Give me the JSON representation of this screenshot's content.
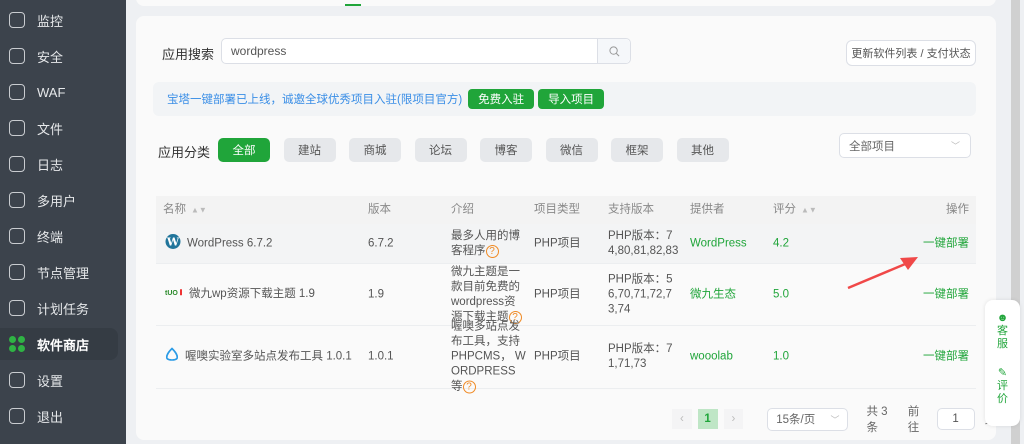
{
  "sidebar": {
    "items": [
      {
        "label": "监控",
        "icon": "monitor-icon"
      },
      {
        "label": "安全",
        "icon": "shield-icon"
      },
      {
        "label": "WAF",
        "icon": "waf-icon"
      },
      {
        "label": "文件",
        "icon": "folder-icon"
      },
      {
        "label": "日志",
        "icon": "log-icon"
      },
      {
        "label": "多用户",
        "icon": "users-icon"
      },
      {
        "label": "终端",
        "icon": "terminal-icon"
      },
      {
        "label": "节点管理",
        "icon": "cube-icon"
      },
      {
        "label": "计划任务",
        "icon": "calendar-icon"
      },
      {
        "label": "软件商店",
        "icon": "store-icon",
        "active": true
      },
      {
        "label": "设置",
        "icon": "gear-icon"
      },
      {
        "label": "退出",
        "icon": "logout-icon"
      }
    ]
  },
  "search": {
    "label": "应用搜索",
    "value": "wordpress"
  },
  "update_button": "更新软件列表 / 支付状态",
  "banner": {
    "text": "宝塔一键部署已上线，诚邀全球优秀项目入驻(限项目官方)",
    "btn_join": "免费入驻",
    "btn_import": "导入项目"
  },
  "category": {
    "label": "应用分类",
    "items": [
      "全部",
      "建站",
      "商城",
      "论坛",
      "博客",
      "微信",
      "框架",
      "其他"
    ],
    "select": "全部项目"
  },
  "table": {
    "headers": [
      "名称",
      "版本",
      "介绍",
      "项目类型",
      "支持版本",
      "提供者",
      "评分",
      "操作"
    ],
    "rows": [
      {
        "name": "WordPress 6.7.2",
        "version": "6.7.2",
        "intro": "最多人用的博客程序",
        "type": "PHP项目",
        "support": "PHP版本：74,80,81,82,83",
        "provider": "WordPress",
        "score": "4.2",
        "action": "一键部署"
      },
      {
        "name": "微九wp资源下载主题 1.9",
        "version": "1.9",
        "intro": "微九主题是一款目前免费的wordpress资源下载主题",
        "type": "PHP项目",
        "support": "PHP版本：56,70,71,72,73,74",
        "provider": "微九生态",
        "score": "5.0",
        "action": "一键部署"
      },
      {
        "name": "喔噢实验室多站点发布工具 1.0.1",
        "version": "1.0.1",
        "intro": "喔噢多站点发布工具，支持PHPCMS， WORDPRESS等",
        "type": "PHP项目",
        "support": "PHP版本：71,71,73",
        "provider": "wooolab",
        "score": "1.0",
        "action": "一键部署"
      }
    ]
  },
  "pagination": {
    "current": "1",
    "page_size": "15条/页",
    "total": "共 3 条",
    "goto": "前往",
    "goto_value": "1",
    "page_unit": "页"
  },
  "float": {
    "service": "客服",
    "review": "评价"
  },
  "colors": {
    "accent": "#20a53a",
    "sidebar": "#3c434c"
  }
}
